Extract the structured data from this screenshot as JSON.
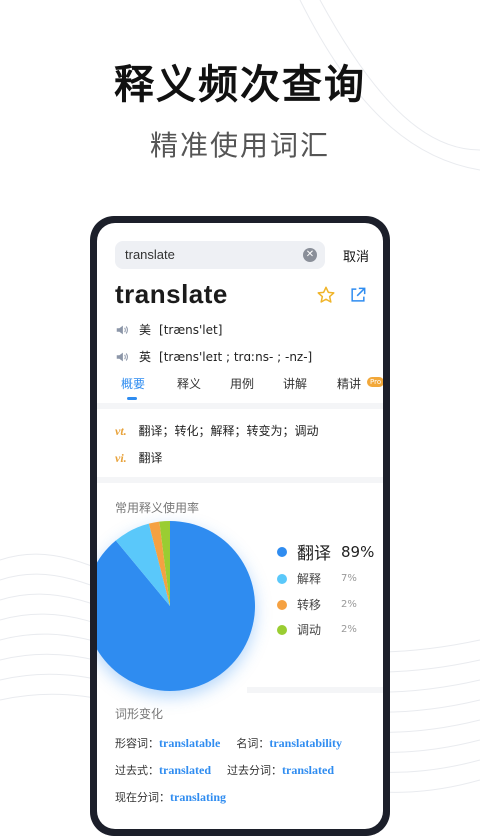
{
  "headline": "释义频次查询",
  "subheadline": "精准使用词汇",
  "search": {
    "value": "translate",
    "cancel_label": "取消"
  },
  "entry": {
    "word": "translate",
    "pronunciations": [
      {
        "region": "美",
        "ipa": "[træns'let]"
      },
      {
        "region": "英",
        "ipa": "[træns'leɪt ; trɑːns- ; -nz-]"
      }
    ]
  },
  "tabs": [
    {
      "label": "概要",
      "active": true
    },
    {
      "label": "释义"
    },
    {
      "label": "用例"
    },
    {
      "label": "讲解"
    },
    {
      "label": "精讲",
      "badge": "Pro"
    }
  ],
  "definitions": [
    {
      "pos": "vt.",
      "text": "翻译；转化；解释；转变为；调动"
    },
    {
      "pos": "vi.",
      "text": "翻译"
    }
  ],
  "usage": {
    "title": "常用释义使用率",
    "items": [
      {
        "name": "翻译",
        "pct": "89%",
        "value": 89,
        "color": "#2f8cf0"
      },
      {
        "name": "解释",
        "pct": "7%",
        "value": 7,
        "color": "#5ac8fa"
      },
      {
        "name": "转移",
        "pct": "2%",
        "value": 2,
        "color": "#f5a142"
      },
      {
        "name": "调动",
        "pct": "2%",
        "value": 2,
        "color": "#9acd32"
      }
    ]
  },
  "morphology": {
    "title": "词形变化",
    "rows": [
      [
        {
          "label": "形容词：",
          "value": "translatable"
        },
        {
          "label": "名词：",
          "value": "translatability"
        }
      ],
      [
        {
          "label": "过去式：",
          "value": "translated"
        },
        {
          "label": "过去分词：",
          "value": "translated"
        }
      ],
      [
        {
          "label": "现在分词：",
          "value": "translating"
        }
      ]
    ]
  },
  "colors": {
    "accent": "#2f8cf0",
    "pos": "#e8a23a",
    "star": "#f0b429",
    "phone_frame": "#1c1f2a"
  },
  "icons": {
    "speaker": "speaker-icon",
    "star": "star-icon",
    "share": "share-icon",
    "clear": "clear-icon"
  }
}
